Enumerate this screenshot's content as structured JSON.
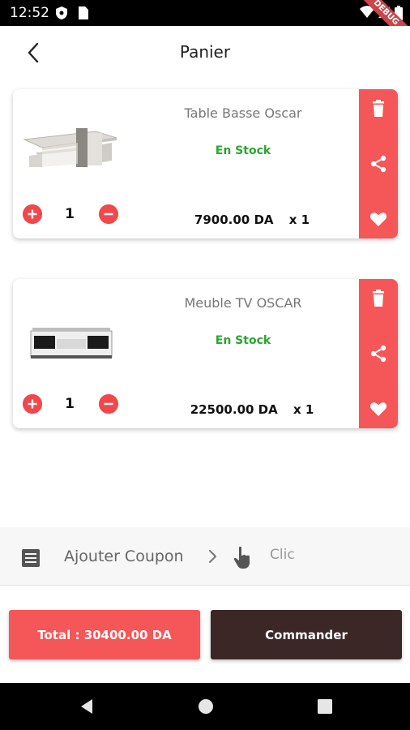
{
  "status_bar": {
    "time": "12:52",
    "debug_label": "DEBUG"
  },
  "app_bar": {
    "title": "Panier"
  },
  "cart": {
    "items": [
      {
        "name": "Table Basse Oscar",
        "stock": "En Stock",
        "quantity": "1",
        "price": "7900.00 DA",
        "qty_suffix": "x 1"
      },
      {
        "name": "Meuble TV OSCAR",
        "stock": "En Stock",
        "quantity": "1",
        "price": "22500.00 DA",
        "qty_suffix": "x 1"
      }
    ]
  },
  "coupon": {
    "label": "Ajouter Coupon",
    "action": "Clic"
  },
  "footer": {
    "total_label": "Total : 30400.00 DA",
    "order_label": "Commander"
  },
  "colors": {
    "accent": "#f55658",
    "stock": "#2aa530",
    "order_button": "#3c2727"
  }
}
